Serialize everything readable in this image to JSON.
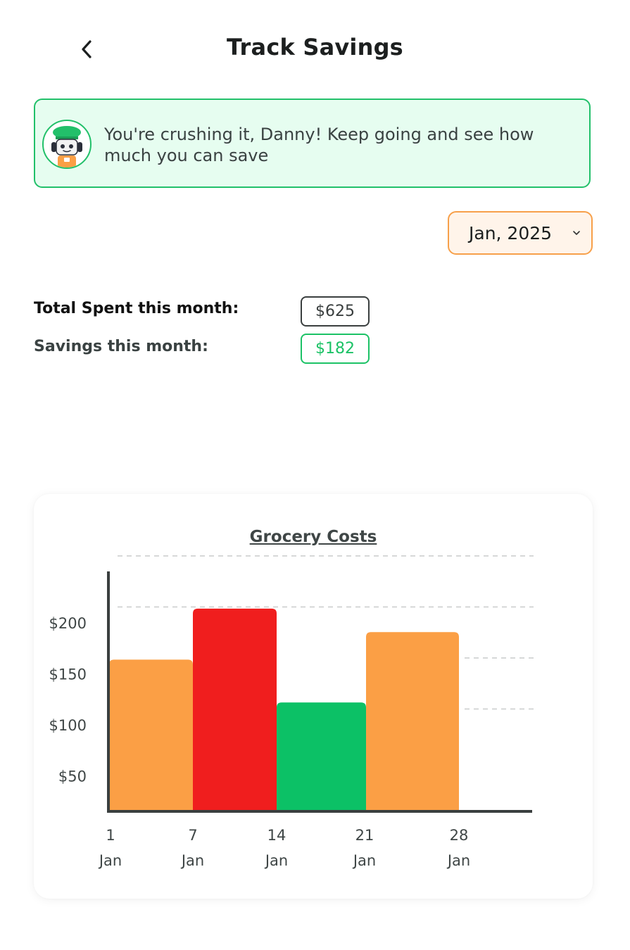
{
  "header": {
    "title": "Track Savings",
    "back_icon": "chevron-left-icon"
  },
  "banner": {
    "message": "You're crushing it, Danny! Keep going and see how much you can save",
    "avatar_icon": "chef-robot-mascot-icon",
    "border_color": "#22c06a",
    "background_color": "#e6fdf0"
  },
  "month_selector": {
    "value": "Jan, 2025",
    "icon": "chevron-down-icon",
    "border_color": "#f7a04a"
  },
  "stats": {
    "spent_label": "Total Spent this month:",
    "spent_value": "$625",
    "savings_label": "Savings this month:",
    "savings_value": "$182",
    "savings_color": "#1cc266"
  },
  "chart_data": {
    "type": "bar",
    "title": "Grocery Costs",
    "categories": [
      "1 Jan",
      "7 Jan",
      "14 Jan",
      "21 Jan",
      "28 Jan"
    ],
    "category_lines": [
      [
        "1",
        "Jan"
      ],
      [
        "7",
        "Jan"
      ],
      [
        "14",
        "Jan"
      ],
      [
        "21",
        "Jan"
      ],
      [
        "28",
        "Jan"
      ]
    ],
    "values": [
      148,
      198,
      106,
      175
    ],
    "bar_colors": [
      "#fb9f45",
      "#f01e1e",
      "#0cc166",
      "#fb9f45"
    ],
    "y_ticks": [
      50,
      100,
      150,
      200
    ],
    "y_tick_labels": [
      "$50",
      "$100",
      "$150",
      "$200"
    ],
    "ylim": [
      0,
      225
    ],
    "grid": "dashed horizontal",
    "xlabel": "",
    "ylabel": ""
  }
}
